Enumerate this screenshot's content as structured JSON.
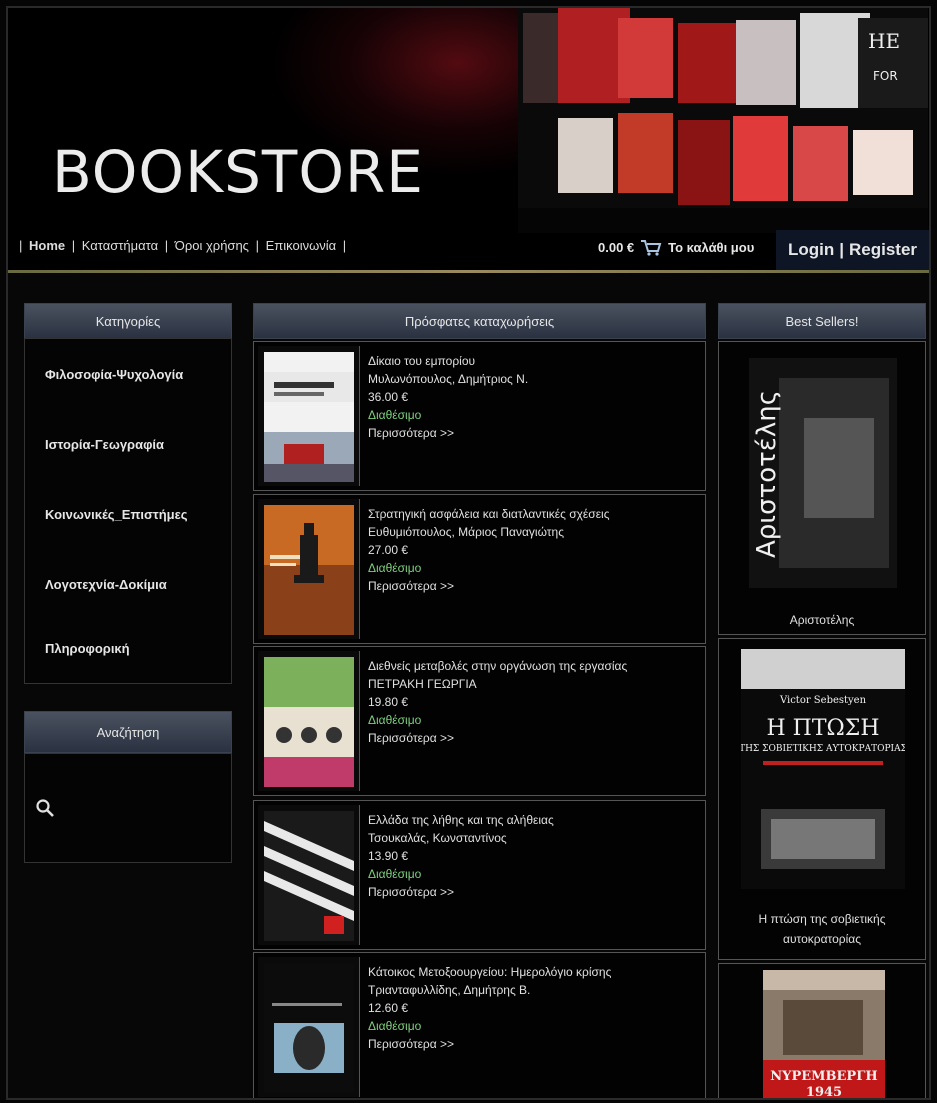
{
  "header": {
    "logo": "BOOKSTORE",
    "nav": [
      "Home",
      "Καταστήματα",
      "Όροι χρήσης",
      "Επικοινωνία"
    ],
    "cart_amount": "0.00 €",
    "cart_label": "Το καλάθι μου",
    "login": "Login",
    "register": "Register",
    "auth_sep": "|"
  },
  "categories": {
    "title": "Κατηγορίες",
    "items": [
      "Φιλοσοφία-Ψυχολογία",
      "Ιστορία-Γεωγραφία",
      "Κοινωνικές_Επιστήμες",
      "Λογοτεχνία-Δοκίμια",
      "Πληροφορική"
    ]
  },
  "search": {
    "title": "Αναζήτηση",
    "icon": "search-icon"
  },
  "recent": {
    "title": "Πρόσφατες καταχωρήσεις",
    "items": [
      {
        "title": "Δίκαιο του εμπορίου",
        "author": "Μυλωνόπουλος, Δημήτριος Ν.",
        "price": "36.00 €",
        "status": "Διαθέσιμο",
        "more": "Περισσότερα >>"
      },
      {
        "title": "Στρατηγική ασφάλεια και διατλαντικές σχέσεις",
        "author": "Ευθυμιόπουλος, Μάριος Παναγιώτης",
        "price": "27.00 €",
        "status": "Διαθέσιμο",
        "more": "Περισσότερα >>"
      },
      {
        "title": "Διεθνείς μεταβολές στην οργάνωση της εργασίας",
        "author": "ΠΕΤΡΑΚΗ ΓΕΩΡΓΙΑ",
        "price": "19.80 €",
        "status": "Διαθέσιμο",
        "more": "Περισσότερα >>"
      },
      {
        "title": "Ελλάδα της λήθης και της αλήθειας",
        "author": "Τσουκαλάς, Κωνσταντίνος",
        "price": "13.90 €",
        "status": "Διαθέσιμο",
        "more": "Περισσότερα >>"
      },
      {
        "title": "Κάτοικος Μετοξοουργείου: Ημερολόγιο κρίσης",
        "author": "Τριανταφυλλίδης, Δημήτρης Β.",
        "price": "12.60 €",
        "status": "Διαθέσιμο",
        "more": "Περισσότερα >>"
      }
    ]
  },
  "bestsellers": {
    "title": "Best Sellers!",
    "items": [
      {
        "caption": "Αριστοτέλης",
        "cover_text": "Αριστοτέλης"
      },
      {
        "caption": "Η πτώση της σοβιετικής αυτοκρατορίας",
        "cover_author": "Victor Sebestyen",
        "cover_title": "Η ΠΤΩΣΗ",
        "cover_sub": "ΤΗΣ ΣΟΒΙΕΤΙΚΗΣ ΑΥΤΟΚΡΑΤΟΡΙΑΣ"
      },
      {
        "caption": "",
        "cover_title": "ΝΥΡΕΜΒΕΡΓΗ",
        "cover_year": "1945"
      }
    ]
  },
  "colors": {
    "accent_green": "#7ed07e",
    "panel_head": "#3a4250",
    "auth_bg": "#0e1626"
  }
}
